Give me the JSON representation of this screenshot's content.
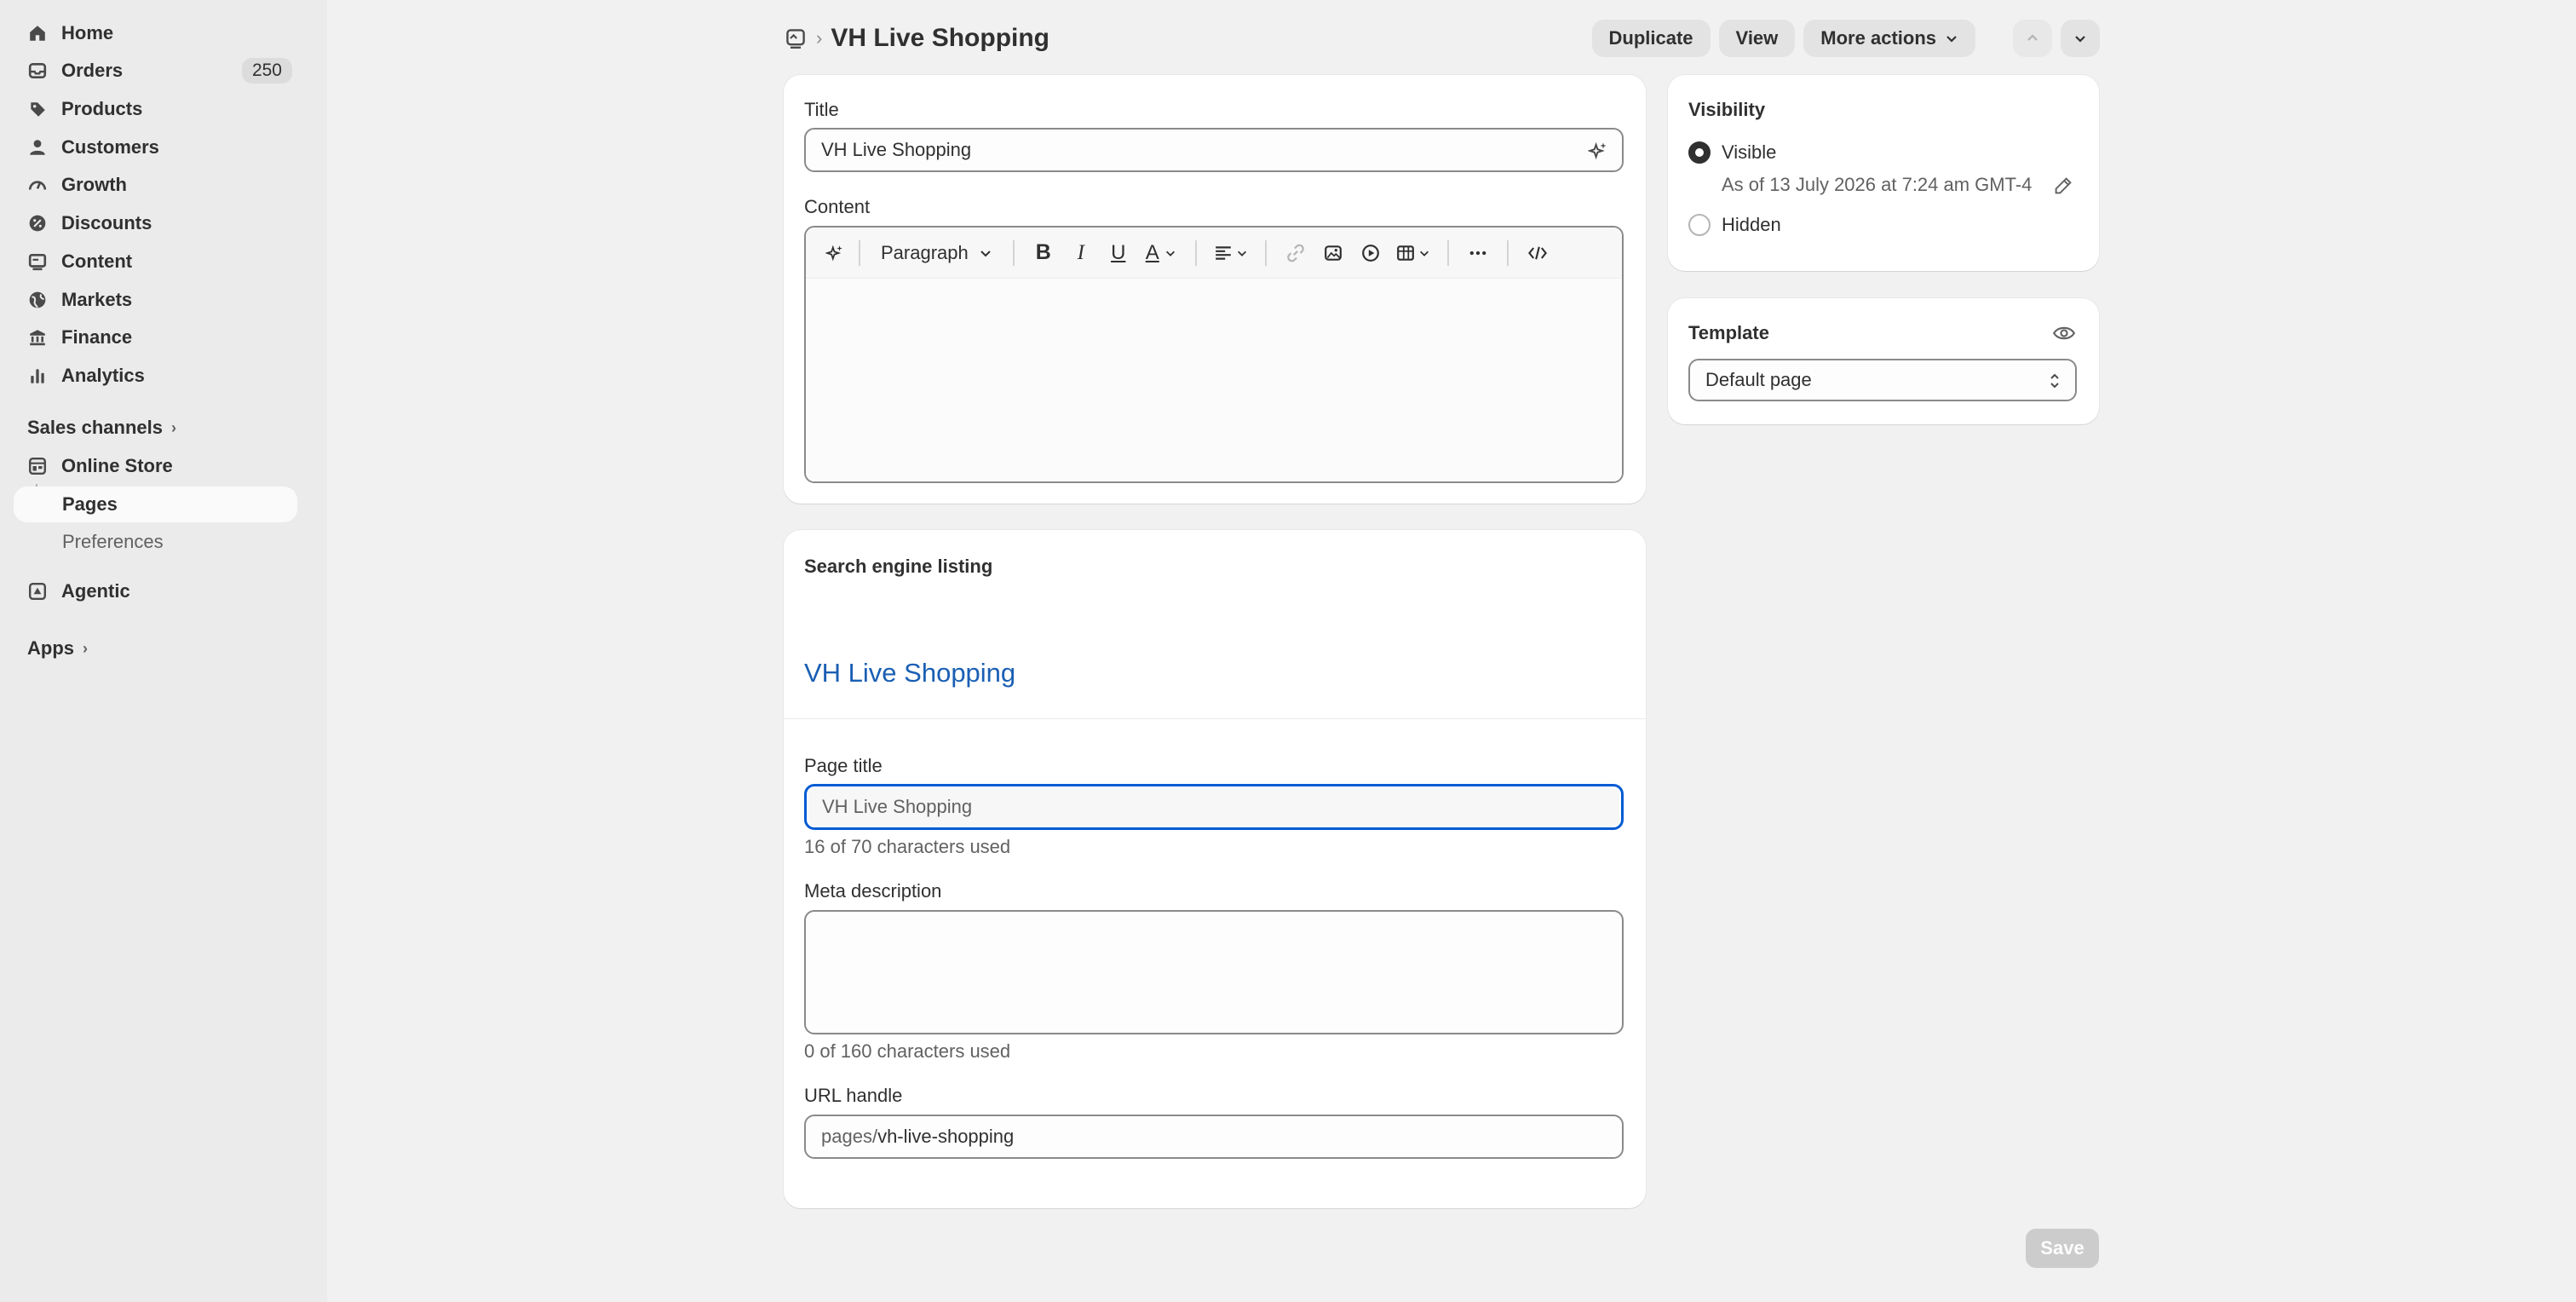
{
  "sidebar": {
    "items": [
      {
        "label": "Home",
        "icon": "home-icon"
      },
      {
        "label": "Orders",
        "icon": "inbox-icon",
        "badge": "250"
      },
      {
        "label": "Products",
        "icon": "tag-icon"
      },
      {
        "label": "Customers",
        "icon": "person-icon"
      },
      {
        "label": "Growth",
        "icon": "gauge-icon"
      },
      {
        "label": "Discounts",
        "icon": "discount-icon"
      },
      {
        "label": "Content",
        "icon": "content-icon"
      },
      {
        "label": "Markets",
        "icon": "globe-icon"
      },
      {
        "label": "Finance",
        "icon": "bank-icon"
      },
      {
        "label": "Analytics",
        "icon": "bar-chart-icon"
      }
    ],
    "sales_channels": "Sales channels",
    "online_store": "Online Store",
    "pages": "Pages",
    "preferences": "Preferences",
    "agentic": "Agentic",
    "apps": "Apps"
  },
  "header": {
    "title": "VH Live Shopping",
    "duplicate": "Duplicate",
    "view": "View",
    "more_actions": "More actions"
  },
  "page_card": {
    "title_label": "Title",
    "title_value": "VH Live Shopping",
    "content_label": "Content",
    "paragraph": "Paragraph"
  },
  "seo": {
    "heading": "Search engine listing",
    "preview_title": "VH Live Shopping",
    "page_title_label": "Page title",
    "page_title_placeholder": "VH Live Shopping",
    "page_title_count": "16 of 70 characters used",
    "meta_label": "Meta description",
    "meta_count": "0 of 160 characters used",
    "url_label": "URL handle",
    "url_prefix": "pages/",
    "url_value": "vh-live-shopping"
  },
  "visibility": {
    "heading": "Visibility",
    "visible": "Visible",
    "visible_date": "As of 13 July 2026 at 7:24 am GMT-4",
    "hidden": "Hidden",
    "selected": "Visible"
  },
  "template": {
    "heading": "Template",
    "value": "Default page"
  },
  "footer": {
    "save": "Save"
  },
  "colors": {
    "accent": "#005bd3",
    "seo_link": "#1a5fb4"
  }
}
